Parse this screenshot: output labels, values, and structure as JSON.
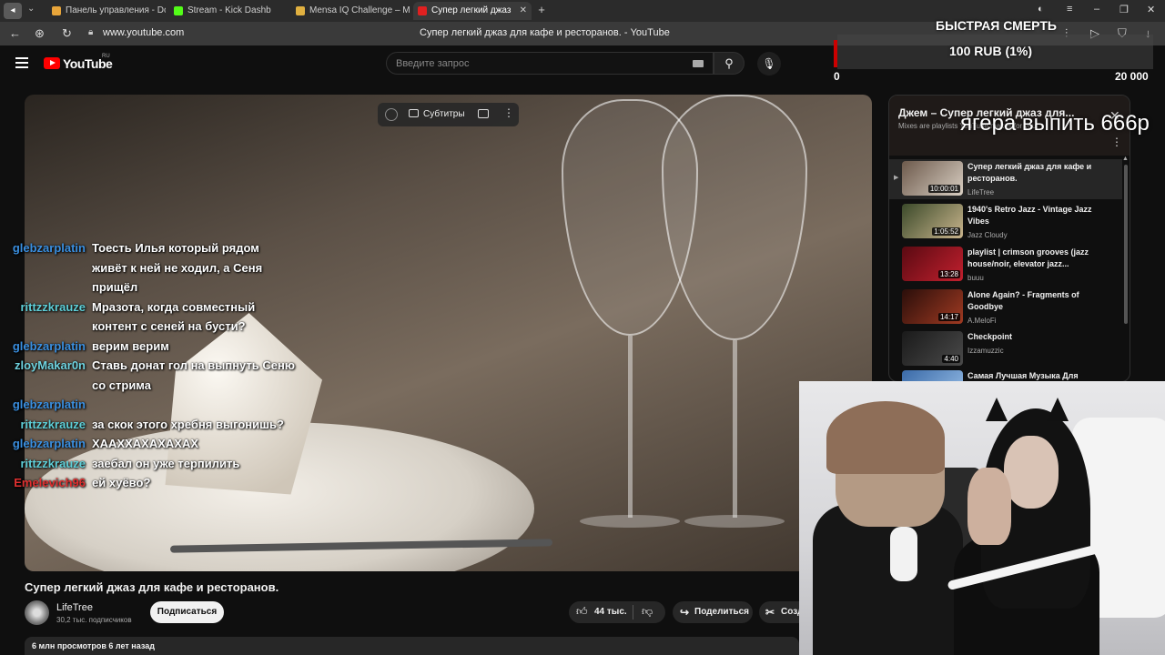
{
  "browser": {
    "tabs": [
      {
        "label": "Панель управления - Don",
        "fav": "#e8a53a"
      },
      {
        "label": "Stream - Kick Dashb",
        "fav": "#53fc18"
      },
      {
        "label": "Mensa IQ Challenge – Me",
        "fav": "#e0b040"
      },
      {
        "label": "Супер легкий джаз",
        "fav": "#e02020"
      }
    ],
    "url": "www.youtube.com",
    "page_title": "Супер легкий джаз для кафе и ресторанов. - YouTube"
  },
  "youtube": {
    "logo": "YouTube",
    "logo_region": "RU",
    "search_placeholder": "Введите запрос"
  },
  "player": {
    "subtitles_label": "Субтитры"
  },
  "video": {
    "title": "Супер легкий джаз для кафе и ресторанов.",
    "channel": "LifeTree",
    "subscribers": "30,2 тыс. подписчиков",
    "subscribe_label": "Подписаться",
    "likes": "44 тыс.",
    "share_label": "Поделиться",
    "create_label": "Созд",
    "stats": "6 млн просмотров  6 лет назад"
  },
  "playlist": {
    "title": "Джем – Супер легкий джаз для...",
    "subtitle": "Mixes are playlists YouTube makes for you",
    "items": [
      {
        "title": "Супер легкий джаз для кафе и ресторанов.",
        "author": "LifeTree",
        "duration": "10:00:01",
        "current": true,
        "colors": [
          "#6d5a4c",
          "#d8cec2"
        ]
      },
      {
        "title": "1940's Retro Jazz - Vintage Jazz Vibes",
        "author": "Jazz Cloudy",
        "duration": "1:05:52",
        "current": false,
        "colors": [
          "#3b4a2a",
          "#c9b48c"
        ]
      },
      {
        "title": "playlist | crimson grooves (jazz house/noir, elevator jazz...",
        "author": "buuu",
        "duration": "13:28",
        "current": false,
        "colors": [
          "#5a0a12",
          "#c2202e"
        ]
      },
      {
        "title": "Alone Again? - Fragments of Goodbye",
        "author": "A.MeloFi",
        "duration": "14:17",
        "current": false,
        "colors": [
          "#2a0e0a",
          "#a03a22"
        ]
      },
      {
        "title": "Checkpoint",
        "author": "Izzamuzzic",
        "duration": "4:40",
        "current": false,
        "colors": [
          "#1a1a1a",
          "#4a4a4a"
        ]
      },
      {
        "title": "Самая Лучшая Музыка Для",
        "author": "",
        "duration": "",
        "current": false,
        "colors": [
          "#3a6aa8",
          "#9ac0e8"
        ]
      }
    ]
  },
  "chat": [
    {
      "user": "glebzarplatin",
      "color": "#3a8fe0",
      "text": "Тоесть Илья который рядом живёт к ней не ходил, а Сеня прищёл"
    },
    {
      "user": "rittzzkrauze",
      "color": "#5ecfd8",
      "text": "Мразота, когда совместный контент с сеней на бусти?"
    },
    {
      "user": "glebzarplatin",
      "color": "#3a8fe0",
      "text": "верим верим"
    },
    {
      "user": "zloyMakar0n",
      "color": "#6fd3e0",
      "text": "Ставь донат гол на выпнуть Сеню со стрима"
    },
    {
      "user": "glebzarplatin",
      "color": "#3a8fe0",
      "text": ""
    },
    {
      "user": "rittzzkrauze",
      "color": "#5ecfd8",
      "text": "за скок этого хребня выгонишь?"
    },
    {
      "user": "glebzarplatin",
      "color": "#3a8fe0",
      "text": "ХААХХАХАХАХАХ"
    },
    {
      "user": "rittzzkrauze",
      "color": "#5ecfd8",
      "text": "заебал он уже терпилить"
    },
    {
      "user": "Emelevich96",
      "color": "#e03030",
      "text": "ей хуёво?"
    }
  ],
  "overlay": {
    "donate_label": "БЫСТРАЯ СМЕРТЬ",
    "donate_amount": "100 RUB (1%)",
    "goal_min": "0",
    "goal_max": "20 000",
    "big_text": "ягера выпить 666р"
  }
}
